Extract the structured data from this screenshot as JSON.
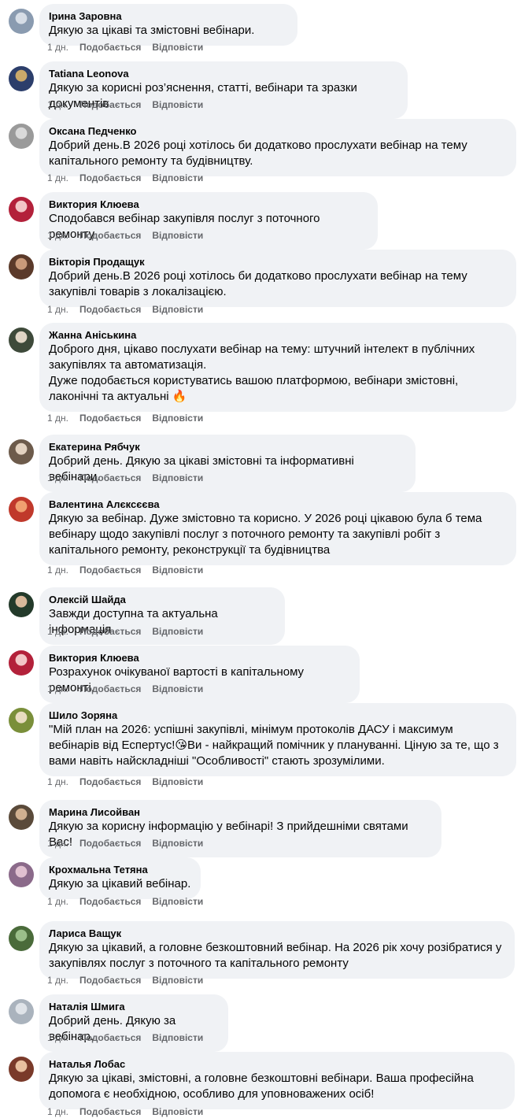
{
  "actions": {
    "time": "1 дн.",
    "like": "Подобається",
    "reply": "Відповісти"
  },
  "comments": [
    {
      "author": "Ірина Заровна",
      "text": "Дякую за цікаві та змістовні вебінари."
    },
    {
      "author": "Tatiana Leonova",
      "text": "Дякую за корисні роз’яснення, статті, вебінари та зразки документів."
    },
    {
      "author": "Оксана Педченко",
      "text": "Добрий день.В 2026 році хотілось би додатково прослухати вебінар на тему\nкапітального ремонту та будівництву."
    },
    {
      "author": "Виктория Клюева",
      "text": "Сподобався вебінар закупівля послуг з поточного ремонту"
    },
    {
      "author": "Вікторія Продащук",
      "text": "Добрий день.В 2026 році хотілось би додатково прослухати вебінар на тему\nзакупівлі товарів з локалізацією."
    },
    {
      "author": "Жанна Аніськина",
      "text": "Доброго дня, цікаво послухати вебінар на тему: штучний інтелект в публічних\nзакупівлях та автоматизація.\nДуже подобається користуватись вашою платформою, вебінари змістовні,\nлаконічні та актуальні 🔥"
    },
    {
      "author": "Екатерина Рябчук",
      "text": "Добрий день. Дякую за цікаві змістовні та інформативні вебінари."
    },
    {
      "author": "Валентина Алєксєєва",
      "text": "Дякую за вебінар. Дуже змістовно та корисно. У 2026 році цікавою була б тема\nвебінару щодо закупівлі послуг з поточного ремонту та закупівлі робіт з\nкапітального ремонту, реконструкції та будівництва"
    },
    {
      "author": "Олексій Шайда",
      "text": "Завжди доступна та актуальна інформація"
    },
    {
      "author": "Виктория Клюева",
      "text": "Розрахунок очікуваної вартості в капітальному ремонті."
    },
    {
      "author": "Шило Зоряна",
      "text": "\"Мій план на 2026: успішні закупівлі, мінімум протоколів ДАСУ і максимум\nвебінарів від Еспертус!😘Ви - найкращий помічник у плануванні. Ціную за те, що з\nвами навіть найскладніші \"Особливості\" стають зрозумілими."
    },
    {
      "author": "Марина Лисойван",
      "text": "Дякую за корисну інформацію у вебінарі! З прийдешніми святами Вас!"
    },
    {
      "author": "Крохмальна Тетяна",
      "text": "Дякую за цікавий вебінар."
    },
    {
      "author": "Лариса Ващук",
      "text": "Дякую за цікавий, а головне безкоштовний вебінар. На 2026 рік хочу розібратися у\nзакупівлях послуг з поточного та капітального ремонту"
    },
    {
      "author": "Наталія Шмига",
      "text": "Добрий день. Дякую за вебінар."
    },
    {
      "author": "Наталья Лобас",
      "text": "Дякую за цікаві, змістовні, а головне безкоштовні вебінари. Ваша професійна\nдопомога є необхідною, особливо для уповноважених осіб!"
    }
  ]
}
